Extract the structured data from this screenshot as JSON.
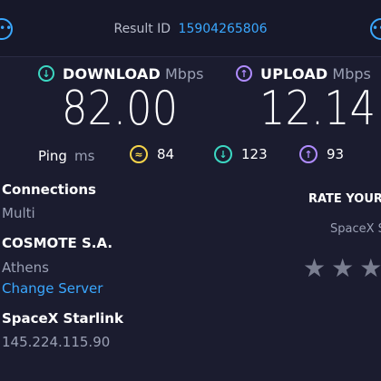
{
  "header": {
    "result_label": "Result ID",
    "result_id": "15904265806",
    "left_button_icon": "more-horizontal-icon",
    "right_button_icon": "more-horizontal-icon"
  },
  "download": {
    "label": "DOWNLOAD",
    "unit": "Mbps",
    "value": "82.00",
    "icon": "arrow-down-circle-icon",
    "color": "#3cd7c2"
  },
  "upload": {
    "label": "UPLOAD",
    "unit": "Mbps",
    "value": "12.14",
    "icon": "arrow-up-circle-icon",
    "color": "#b08cff"
  },
  "ping": {
    "label": "Ping",
    "unit": "ms",
    "idle": {
      "value": "84",
      "icon": "ping-icon",
      "color": "#f6d44a"
    },
    "download": {
      "value": "123",
      "icon": "arrow-down-circle-icon",
      "color": "#3cd7c2"
    },
    "upload": {
      "value": "93",
      "icon": "arrow-up-circle-icon",
      "color": "#b08cff"
    }
  },
  "connections": {
    "title": "Connections",
    "mode": "Multi"
  },
  "server": {
    "provider": "COSMOTE S.A.",
    "city": "Athens",
    "change_label": "Change Server"
  },
  "isp": {
    "name": "SpaceX Starlink",
    "ip": "145.224.115.90"
  },
  "rating": {
    "title": "RATE YOUR",
    "provider": "SpaceX S",
    "stars_filled": 0,
    "stars_visible": 3
  }
}
